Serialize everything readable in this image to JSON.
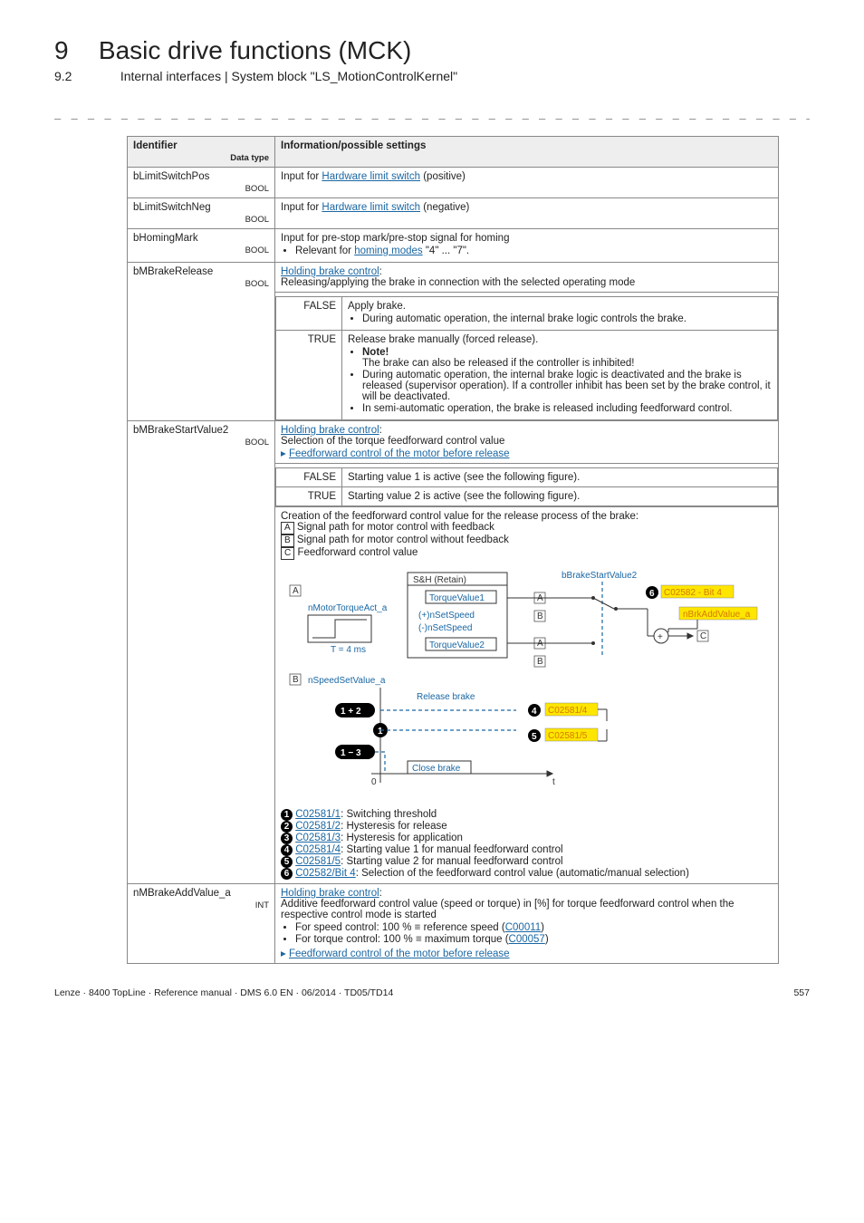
{
  "chapter": {
    "num": "9",
    "title": "Basic drive functions (MCK)"
  },
  "section": {
    "num": "9.2",
    "title": "Internal interfaces | System block \"LS_MotionControlKernel\""
  },
  "dashes": "_ _ _ _ _ _ _ _ _ _ _ _ _ _ _ _ _ _ _ _ _ _ _ _ _ _ _ _ _ _ _ _ _ _ _ _ _ _ _ _ _ _ _ _ _ _ _ _ _ _ _ _ _ _ _ _ _ _ _ _ _ _ _ _",
  "headers": {
    "id": "Identifier",
    "info": "Information/possible settings",
    "datatype": "Data type"
  },
  "rows": {
    "r1": {
      "id": "bLimitSwitchPos",
      "type": "BOOL",
      "pre": "Input for ",
      "link": "Hardware limit switch",
      "post": " (positive)"
    },
    "r2": {
      "id": "bLimitSwitchNeg",
      "type": "BOOL",
      "pre": "Input for ",
      "link": "Hardware limit switch",
      "post": " (negative)"
    },
    "r3": {
      "id": "bHomingMark",
      "type": "BOOL",
      "line1": "Input for pre-stop mark/pre-stop signal for homing",
      "bul_pre": "Relevant for ",
      "bul_link": "homing modes",
      "bul_post": " \"4\" ... \"7\"."
    },
    "r4": {
      "id": "bMBrakeRelease",
      "type": "BOOL",
      "linkTop": "Holding brake control",
      "colon": ":",
      "line1": "Releasing/applying the brake in connection with the selected operating mode",
      "false": {
        "label": "FALSE",
        "t1": "Apply brake.",
        "b1": "During automatic operation, the internal brake logic controls the brake."
      },
      "true": {
        "label": "TRUE",
        "t1": "Release brake manually (forced release).",
        "noteLbl": "Note!",
        "noteTxt": "The brake can also be released if the controller is inhibited!",
        "b1": "During automatic operation, the internal brake logic is deactivated and the brake is released (supervisor operation). If a controller inhibit has been set by the brake control, it will be deactivated.",
        "b2": "In semi-automatic operation, the brake is released including feedforward control."
      }
    },
    "r5": {
      "id": "bMBrakeStartValue2",
      "type": "BOOL",
      "linkTop": "Holding brake control",
      "colon": ":",
      "line1": "Selection of the torque feedforward control value",
      "ref": "Feedforward control of the motor before release",
      "false": {
        "label": "FALSE",
        "txt": "Starting value 1 is active (see the following figure)."
      },
      "true": {
        "label": "TRUE",
        "txt": "Starting value 2 is active (see the following figure)."
      },
      "creation": "Creation of the feedforward control value for the release process of the brake:",
      "A": "Signal path for motor control with feedback",
      "B": "Signal path for motor control without feedback",
      "C": "Feedforward control value",
      "leg1": {
        "code": "C02581/1",
        "txt": ": Switching threshold"
      },
      "leg2": {
        "code": "C02581/2",
        "txt": ": Hysteresis for release"
      },
      "leg3": {
        "code": "C02581/3",
        "txt": ": Hysteresis for application"
      },
      "leg4": {
        "code": "C02581/4",
        "txt": ": Starting value 1 for manual feedforward control"
      },
      "leg5": {
        "code": "C02581/5",
        "txt": ": Starting value 2 for manual feedforward control"
      },
      "leg6": {
        "code": "C02582/Bit 4",
        "txt": ": Selection of the feedforward control value (automatic/manual selection)"
      }
    },
    "r6": {
      "id": "nMBrakeAddValue_a",
      "type": "INT",
      "linkTop": "Holding brake control",
      "colon": ":",
      "line1": "Additive feedforward control value (speed or torque) in [%] for torque feedforward control when the respective control mode is started",
      "b1_pre": "For speed control: 100 % ≡ reference speed (",
      "b1_link": "C00011",
      "b1_post": ")",
      "b2_pre": "For torque control: 100 % ≡ maximum torque (",
      "b2_link": "C00057",
      "b2_post": ")",
      "ref": "Feedforward control of the motor before release"
    }
  },
  "svg": {
    "bStart": "bBrakeStartValue2",
    "sh": "S&H (Retain)",
    "nMotor": "nMotorTorqueAct_a",
    "tv1": "TorqueValue1",
    "tv2": "TorqueValue2",
    "pset": "(+)nSetSpeed",
    "nset": "(-)nSetSpeed",
    "t4": "T = 4 ms",
    "nSpeed": "nSpeedSetValue_a",
    "rel": "Release brake",
    "close": "Close brake",
    "nBrk": "nBrkAddValue_a",
    "c4": "C02581/4",
    "c5": "C02581/5",
    "c6": "C02582 - Bit 4",
    "t": "t",
    "zero": "0"
  },
  "footer": {
    "left": "Lenze · 8400 TopLine · Reference manual · DMS 6.0 EN · 06/2014 · TD05/TD14",
    "right": "557"
  }
}
